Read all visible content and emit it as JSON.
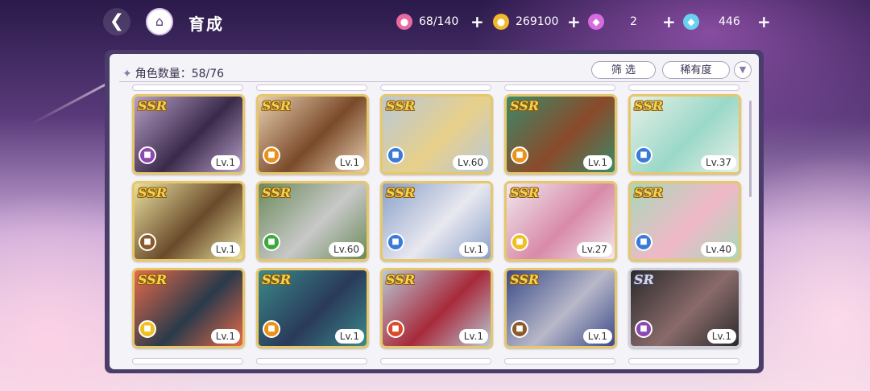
{
  "header": {
    "title": "育成"
  },
  "resources": [
    {
      "name": "candy",
      "icon": "candy-icon",
      "value": "68/140",
      "color": "#e86aa0"
    },
    {
      "name": "coin",
      "icon": "coin-icon",
      "value": "269100",
      "color": "#f0b82a"
    },
    {
      "name": "pink-gem",
      "icon": "pink-gem-icon",
      "value": "2",
      "color": "#d86ae0"
    },
    {
      "name": "blue-gem",
      "icon": "blue-gem-icon",
      "value": "446",
      "color": "#6ad0f0"
    }
  ],
  "panel": {
    "count_label": "角色数量：58/76",
    "filter_label": "筛 选",
    "rarity_label": "稀有度"
  },
  "cards": [
    {
      "rarity": "SSR",
      "level": "Lv.1",
      "attr_color": "#8a4ab0",
      "palette": [
        "#3a2a4a",
        "#b8a0c8"
      ]
    },
    {
      "rarity": "SSR",
      "level": "Lv.1",
      "attr_color": "#e8921a",
      "palette": [
        "#7a4a2a",
        "#e8d0b0"
      ]
    },
    {
      "rarity": "SSR",
      "level": "Lv.60",
      "attr_color": "#3a7ad8",
      "palette": [
        "#e8d08a",
        "#b8c8d8"
      ]
    },
    {
      "rarity": "SSR",
      "level": "Lv.1",
      "attr_color": "#e8921a",
      "palette": [
        "#8a4a2a",
        "#3a8a6a"
      ]
    },
    {
      "rarity": "SSR",
      "level": "Lv.37",
      "attr_color": "#3a7ad8",
      "palette": [
        "#9ad8c8",
        "#e8f0e8"
      ]
    },
    {
      "rarity": "SSR",
      "level": "Lv.1",
      "attr_color": "#8a5a2a",
      "palette": [
        "#6a4a2a",
        "#e8e0a0"
      ]
    },
    {
      "rarity": "SSR",
      "level": "Lv.60",
      "attr_color": "#3aa83a",
      "palette": [
        "#c8c8c8",
        "#6a8a5a"
      ]
    },
    {
      "rarity": "SSR",
      "level": "Lv.1",
      "attr_color": "#3a7ad8",
      "palette": [
        "#e8e8f0",
        "#8aa0c8"
      ]
    },
    {
      "rarity": "SSR",
      "level": "Lv.27",
      "attr_color": "#f0c020",
      "palette": [
        "#d88aa8",
        "#f0e8f0"
      ]
    },
    {
      "rarity": "SSR",
      "level": "Lv.40",
      "attr_color": "#3a7ad8",
      "palette": [
        "#f0b8c8",
        "#a8d8b8"
      ]
    },
    {
      "rarity": "SSR",
      "level": "Lv.1",
      "attr_color": "#f0c020",
      "palette": [
        "#2a3a4a",
        "#e86a4a"
      ]
    },
    {
      "rarity": "SSR",
      "level": "Lv.1",
      "attr_color": "#e8921a",
      "palette": [
        "#2a3a5a",
        "#3a8a8a"
      ]
    },
    {
      "rarity": "SSR",
      "level": "Lv.1",
      "attr_color": "#d84a2a",
      "palette": [
        "#a82a3a",
        "#b8c8d8"
      ]
    },
    {
      "rarity": "SSR",
      "level": "Lv.1",
      "attr_color": "#8a5a2a",
      "palette": [
        "#b8b8c8",
        "#3a4a8a"
      ]
    },
    {
      "rarity": "SR",
      "level": "Lv.1",
      "attr_color": "#8a4ab0",
      "palette": [
        "#8a6a6a",
        "#2a2a2a"
      ]
    }
  ]
}
